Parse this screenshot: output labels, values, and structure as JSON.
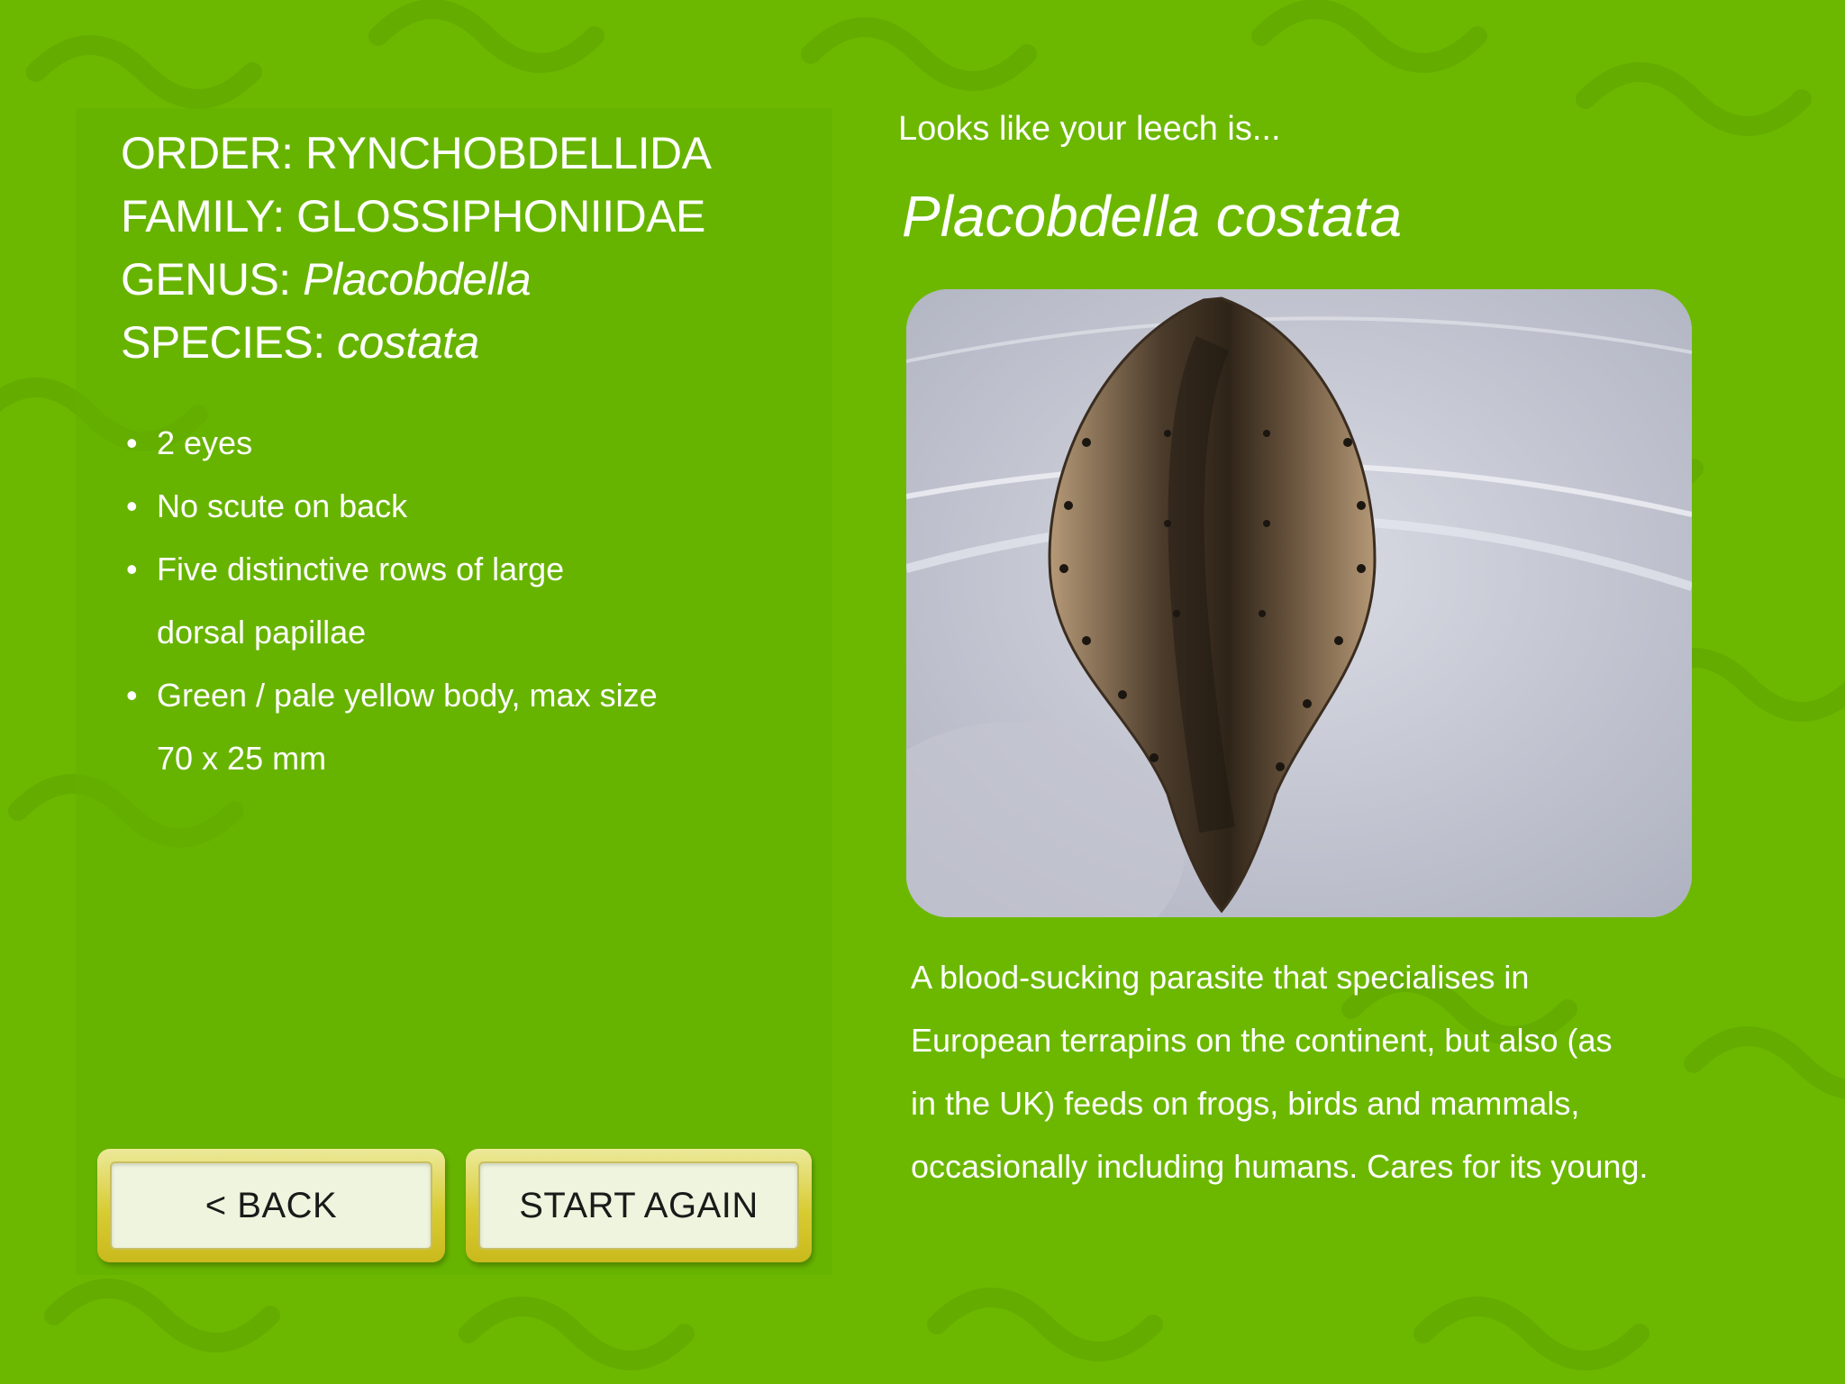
{
  "taxonomy": {
    "order_label": "ORDER:",
    "order_value": "RYNCHOBDELLIDA",
    "family_label": "FAMILY:",
    "family_value": "GLOSSIPHONIIDAE",
    "genus_label": "GENUS:",
    "genus_value": "Placobdella",
    "species_label": "SPECIES:",
    "species_value": "costata"
  },
  "traits": [
    {
      "bullet": "•",
      "line1": "2 eyes",
      "line2": ""
    },
    {
      "bullet": "•",
      "line1": "No scute on back",
      "line2": ""
    },
    {
      "bullet": "•",
      "line1": "Five distinctive rows of large",
      "line2": "dorsal papillae"
    },
    {
      "bullet": "•",
      "line1": "Green / pale yellow body, max size",
      "line2": "70 x 25 mm"
    }
  ],
  "buttons": {
    "back_label": "< BACK",
    "start_again_label": "START AGAIN"
  },
  "result": {
    "intro": "Looks like your leech is...",
    "species_name": "Placobdella costata"
  },
  "photo": {
    "subject": "leech-photo"
  },
  "description_lines": [
    "A blood-sucking parasite that specialises in",
    "European terrapins on the continent, but also (as",
    "in the UK) feeds on frogs, birds and mammals,",
    "occasionally including humans. Cares for its young."
  ],
  "colors": {
    "background": "#6cb800",
    "text": "#ffffff",
    "button_frame": "#d8cc33",
    "button_face": "#eef4dd"
  }
}
